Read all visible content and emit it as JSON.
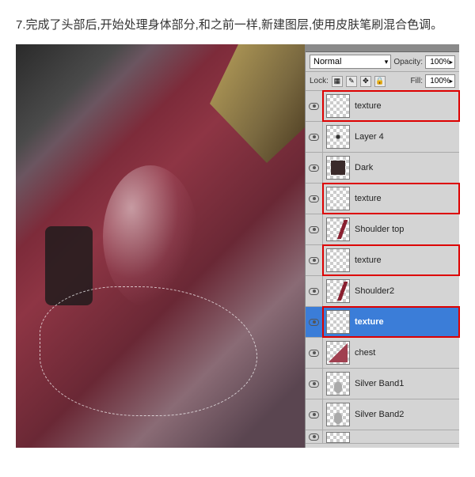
{
  "instruction": "7.完成了头部后,开始处理身体部分,和之前一样,新建图层,使用皮肤笔刷混合色调。",
  "blend_mode": "Normal",
  "opacity": {
    "label": "Opacity:",
    "value": "100%"
  },
  "lock": {
    "label": "Lock:"
  },
  "fill": {
    "label": "Fill:",
    "value": "100%"
  },
  "layers": [
    {
      "name": "texture",
      "highlighted": true,
      "thumb": "transparent"
    },
    {
      "name": "Layer 4",
      "highlighted": false,
      "thumb": "dot"
    },
    {
      "name": "Dark",
      "highlighted": false,
      "thumb": "dark-fill"
    },
    {
      "name": "texture",
      "highlighted": true,
      "thumb": "transparent"
    },
    {
      "name": "Shoulder top",
      "highlighted": false,
      "thumb": "red-stroke"
    },
    {
      "name": "texture",
      "highlighted": true,
      "thumb": "transparent"
    },
    {
      "name": "Shoulder2",
      "highlighted": false,
      "thumb": "red-stroke"
    },
    {
      "name": "texture",
      "highlighted": true,
      "thumb": "transparent",
      "selected": true
    },
    {
      "name": "chest",
      "highlighted": false,
      "thumb": "red-shape"
    },
    {
      "name": "Silver Band1",
      "highlighted": false,
      "thumb": "gray-band"
    },
    {
      "name": "Silver Band2",
      "highlighted": false,
      "thumb": "gray-band"
    },
    {
      "name": "",
      "highlighted": false,
      "thumb": "transparent",
      "partial": true
    }
  ]
}
